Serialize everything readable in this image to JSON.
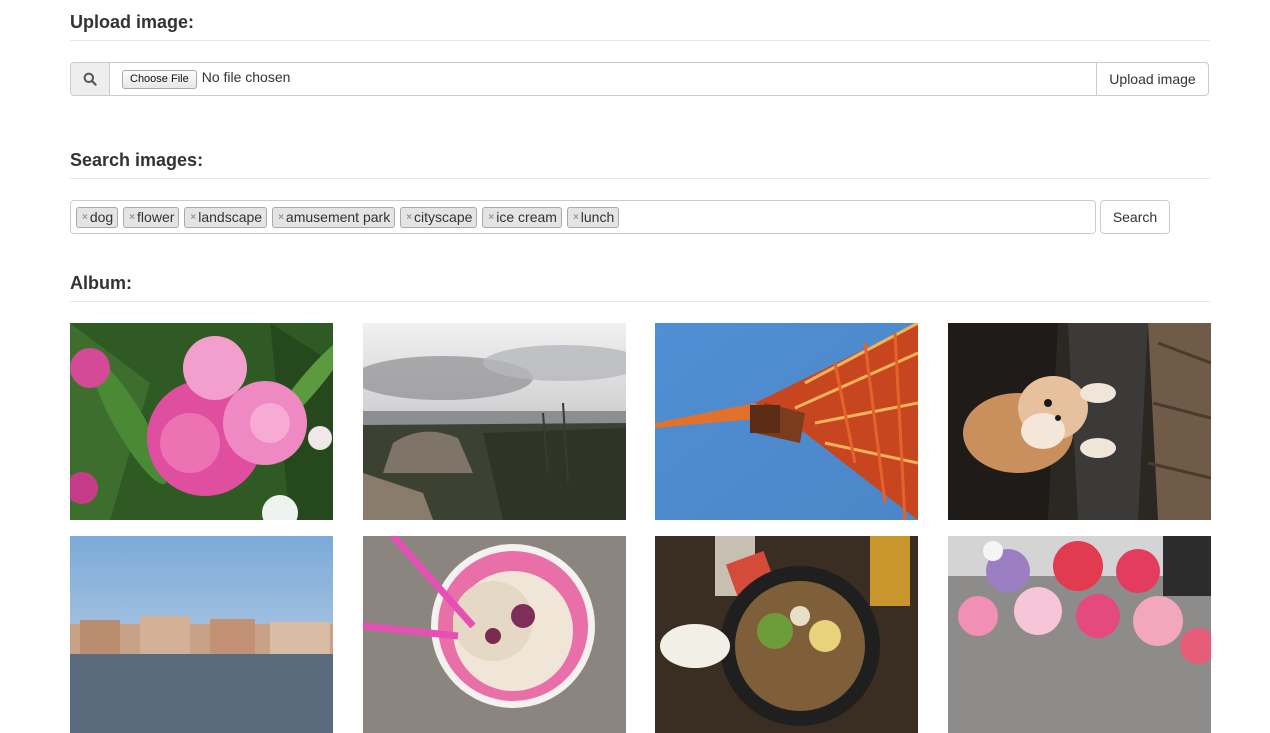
{
  "upload": {
    "title": "Upload image:",
    "choose_file_label": "Choose File",
    "file_status": "No file chosen",
    "upload_button": "Upload image"
  },
  "search": {
    "title": "Search images:",
    "tags": [
      "dog",
      "flower",
      "landscape",
      "amusement park",
      "cityscape",
      "ice cream",
      "lunch"
    ],
    "search_button": "Search"
  },
  "album": {
    "title": "Album:",
    "photos": [
      {
        "subject": "pink peony flowers"
      },
      {
        "subject": "rocky hilltop landscape under cloudy sky"
      },
      {
        "subject": "red lattice tower against blue sky"
      },
      {
        "subject": "shiba dog sitting on wooden deck"
      },
      {
        "subject": "waterfront buildings at dusk"
      },
      {
        "subject": "ice cream cup with pink straw"
      },
      {
        "subject": "lunch bowl with drinks"
      },
      {
        "subject": "flower market bouquets"
      }
    ]
  },
  "icons": {
    "search": "search-icon",
    "tag_remove": "remove-tag-icon"
  }
}
